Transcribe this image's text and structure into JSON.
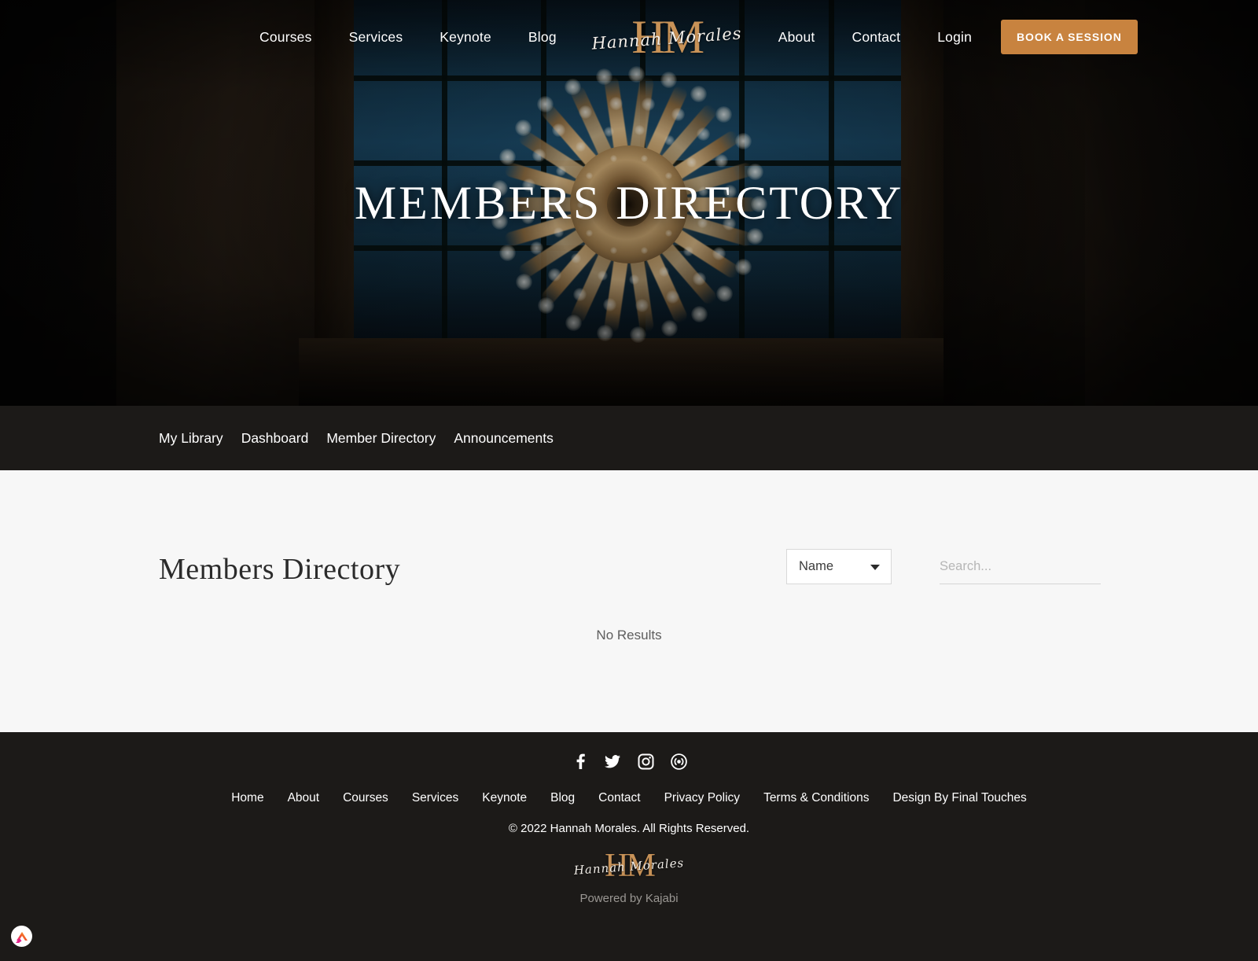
{
  "header": {
    "nav_left": [
      {
        "label": "Courses",
        "name": "nav-courses"
      },
      {
        "label": "Services",
        "name": "nav-services"
      },
      {
        "label": "Keynote",
        "name": "nav-keynote"
      },
      {
        "label": "Blog",
        "name": "nav-blog"
      }
    ],
    "logo": {
      "monogram": "HM",
      "script": "Hannah Morales"
    },
    "nav_right": [
      {
        "label": "About",
        "name": "nav-about"
      },
      {
        "label": "Contact",
        "name": "nav-contact"
      },
      {
        "label": "Login",
        "name": "nav-login"
      }
    ],
    "cta_label": "BOOK A SESSION",
    "cta_color": "#c8833f"
  },
  "hero": {
    "title": "MEMBERS DIRECTORY"
  },
  "subnav": {
    "items": [
      {
        "label": "My Library",
        "name": "subnav-my-library"
      },
      {
        "label": "Dashboard",
        "name": "subnav-dashboard"
      },
      {
        "label": "Member Directory",
        "name": "subnav-member-directory"
      },
      {
        "label": "Announcements",
        "name": "subnav-announcements"
      }
    ]
  },
  "main": {
    "title": "Members Directory",
    "filter_selected": "Name",
    "search_placeholder": "Search...",
    "search_value": "",
    "empty_state": "No Results"
  },
  "footer": {
    "socials": [
      {
        "name": "facebook-icon",
        "label": "Facebook"
      },
      {
        "name": "twitter-icon",
        "label": "Twitter"
      },
      {
        "name": "instagram-icon",
        "label": "Instagram"
      },
      {
        "name": "podcast-icon",
        "label": "Podcast"
      }
    ],
    "links": [
      {
        "label": "Home",
        "name": "footer-link-home"
      },
      {
        "label": "About",
        "name": "footer-link-about"
      },
      {
        "label": "Courses",
        "name": "footer-link-courses"
      },
      {
        "label": "Services",
        "name": "footer-link-services"
      },
      {
        "label": "Keynote",
        "name": "footer-link-keynote"
      },
      {
        "label": "Blog",
        "name": "footer-link-blog"
      },
      {
        "label": "Contact",
        "name": "footer-link-contact"
      },
      {
        "label": "Privacy Policy",
        "name": "footer-link-privacy-policy"
      },
      {
        "label": "Terms & Conditions",
        "name": "footer-link-terms"
      },
      {
        "label": "Design By Final Touches",
        "name": "footer-link-design-credit"
      }
    ],
    "copyright": "© 2022 Hannah Morales. All Rights Reserved.",
    "logo": {
      "monogram": "HM",
      "script": "Hannah Morales"
    },
    "powered_by": "Powered by Kajabi"
  },
  "badge": {
    "name": "kajabi-badge-icon"
  }
}
